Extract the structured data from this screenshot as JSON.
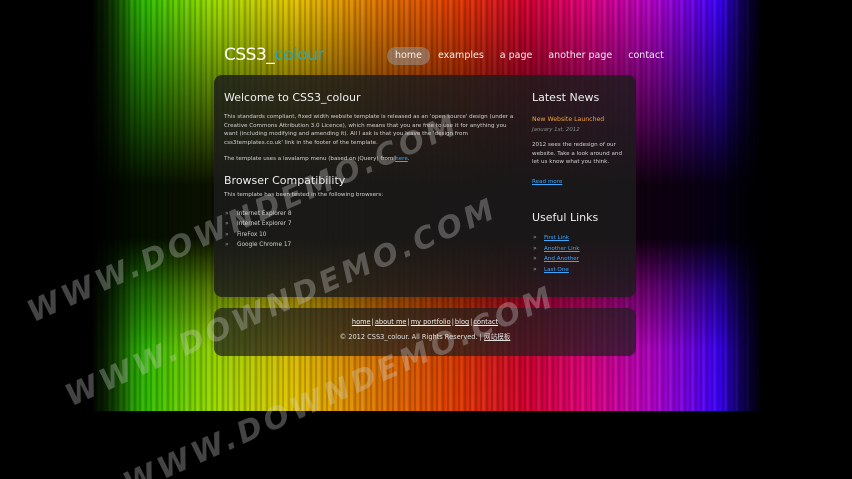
{
  "logo": {
    "main": "CSS3_",
    "sub": "colour"
  },
  "menu": [
    {
      "label": "home",
      "active": true
    },
    {
      "label": "examples",
      "active": false
    },
    {
      "label": "a page",
      "active": false
    },
    {
      "label": "another page",
      "active": false
    },
    {
      "label": "contact",
      "active": false
    }
  ],
  "main": {
    "welcome_title": "Welcome to CSS3_colour",
    "welcome_text": "This standards compliant, fixed width website template is released as an 'open source' design (under a Creative Commons Attribution 3.0 Licence), which means that you are free to use it for anything you want (including modifying and amending it). All I ask is that you leave the 'design from css3templates.co.uk' link in the footer of the template.",
    "lava_text": "The template uses a lavalamp menu (based on jQuery) from",
    "lava_link": "here",
    "compat_title": "Browser Compatibility",
    "compat_text": "This template has been tested in the following browsers:",
    "browsers": [
      "Internet Explorer 8",
      "Internet Explorer 7",
      "FireFox 10",
      "Google Chrome 17"
    ]
  },
  "sidebar": {
    "news_title": "Latest News",
    "news_headline": "New Website Launched",
    "news_date": "January 1st, 2012",
    "news_body": "2012 sees the redesign of our website. Take a look around and let us know what you think.",
    "read_more": "Read more",
    "links_title": "Useful Links",
    "links": [
      "First Link",
      "Another Link",
      "And Another",
      "Last One"
    ]
  },
  "footer": {
    "links": [
      "home",
      "about me",
      "my portfolio",
      "blog",
      "contact"
    ],
    "separator": "|",
    "copyright": "© 2012 CSS3_colour. All Rights Reserved. |",
    "copyright_link": "网站模板"
  },
  "watermark": {
    "text": "WWW.DOWNDEMO.COM"
  },
  "colors": {
    "accent_link": "#3aa8ff",
    "logo_sub": "#1ea7c8",
    "news_headline": "#f0a23a",
    "background": "#000000"
  }
}
